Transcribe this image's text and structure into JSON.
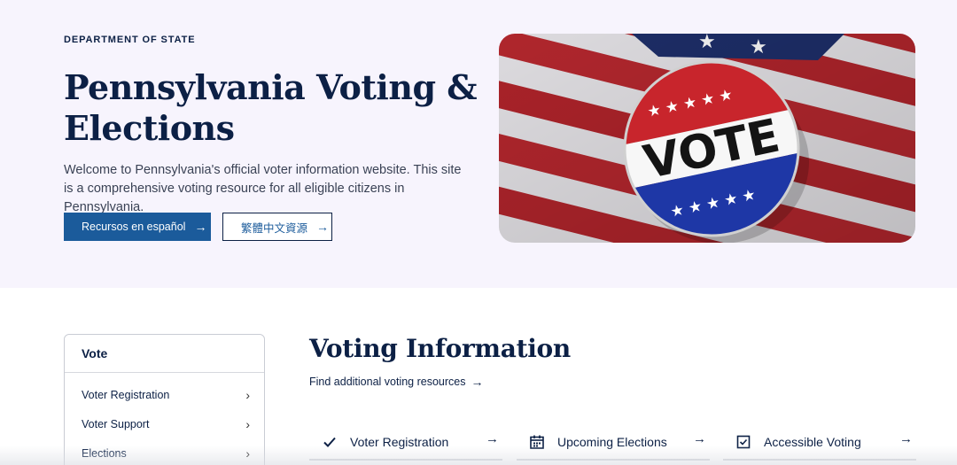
{
  "hero": {
    "eyebrow": "DEPARTMENT OF STATE",
    "title": "Pennsylvania Voting & Elections",
    "description": "Welcome to Pennsylvania's official voter information website. This site is a comprehensive voting resource for all eligible citizens in Pennsylvania.",
    "buttons": {
      "spanish": "Recursos en español",
      "chinese": "繁體中文資源"
    },
    "image": {
      "button_text": "VOTE"
    }
  },
  "sidenav": {
    "heading": "Vote",
    "items": [
      {
        "label": "Voter Registration"
      },
      {
        "label": "Voter Support"
      },
      {
        "label": "Elections"
      }
    ]
  },
  "main": {
    "title": "Voting Information",
    "resources_link": "Find additional voting resources",
    "cards": [
      {
        "label": "Voter Registration",
        "icon": "checkmark-icon"
      },
      {
        "label": "Upcoming Elections",
        "icon": "calendar-icon"
      },
      {
        "label": "Accessible Voting",
        "icon": "checkbox-icon"
      }
    ]
  },
  "colors": {
    "navy": "#0c2045",
    "primary_button": "#1b5b9b",
    "hero_bg": "#f7f4fd"
  }
}
